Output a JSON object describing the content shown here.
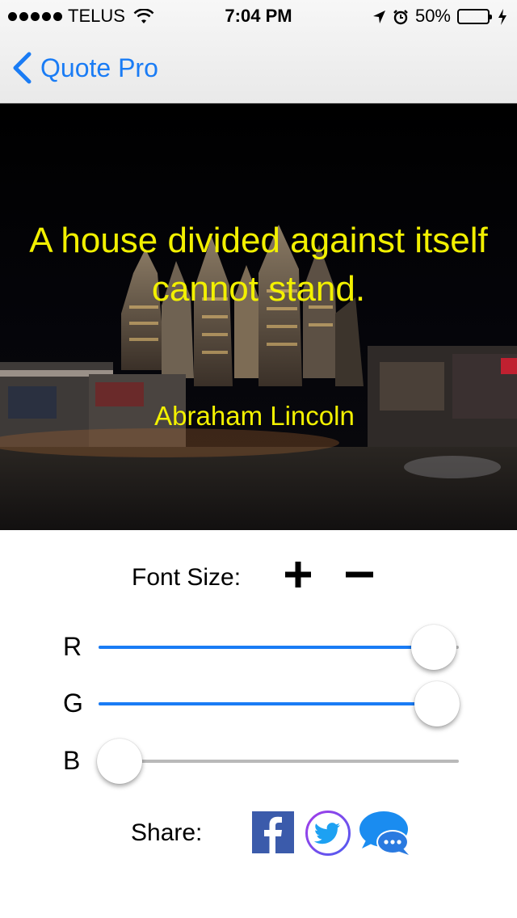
{
  "status_bar": {
    "carrier": "TELUS",
    "time": "7:04 PM",
    "battery": "50%",
    "battery_level": 0.5
  },
  "nav": {
    "back_label": "Quote Pro"
  },
  "quote": {
    "text": "A house divided against itself cannot stand.",
    "author": "Abraham Lincoln",
    "text_color": "#f2f000"
  },
  "controls": {
    "font_size_label": "Font Size:",
    "increase_icon": "plus-icon",
    "decrease_icon": "minus-icon",
    "sliders": [
      {
        "label": "R",
        "value": 0.93
      },
      {
        "label": "G",
        "value": 0.94
      },
      {
        "label": "B",
        "value": 0.0
      }
    ],
    "accent": "#1a7cf5"
  },
  "share": {
    "label": "Share:",
    "targets": [
      "facebook-icon",
      "twitter-icon",
      "messages-icon"
    ]
  }
}
